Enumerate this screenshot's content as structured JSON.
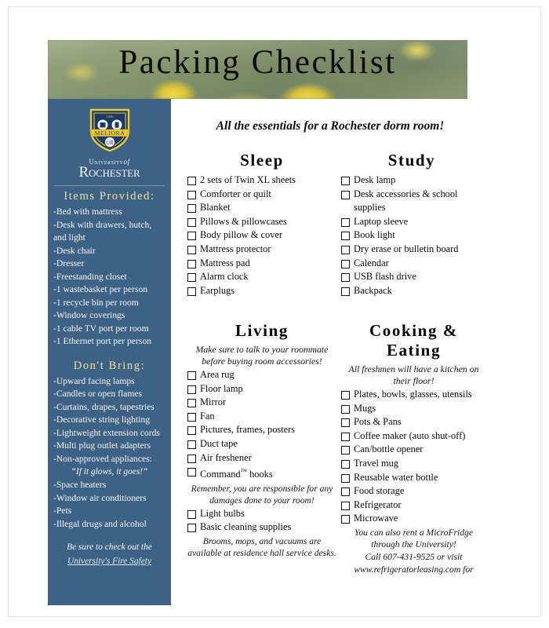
{
  "banner": {
    "title": "Packing Checklist"
  },
  "sidebar": {
    "logo": {
      "crest_motto": "MELIORA",
      "crest_year": "1850"
    },
    "wordmark": {
      "line1_pre": "University",
      "line1_italic": "of",
      "line2": "Rochester"
    },
    "provided_heading": "Items Provided:",
    "provided_items": [
      "-Bed with mattress",
      "-Desk with drawers, hutch, and light",
      "-Desk chair",
      "-Dresser",
      "-Freestanding closet",
      "-1 wastebasket per person",
      "-1 recycle bin per room",
      "-Window coverings",
      "-1 cable TV port per room",
      "-1 Ethernet port per person"
    ],
    "dont_bring_heading": "Don't Bring:",
    "dont_bring_items": [
      "-Upward facing lamps",
      "-Candles or open flames",
      "-Curtains, drapes, tapestries",
      "-Decorative string lighting",
      "-Lightweight extension cords",
      "-Multi plug outlet adapters",
      "-Non-approved appliances:"
    ],
    "appliance_quote": "“If it glows, it goes!”",
    "dont_bring_items_2": [
      "-Space heaters",
      "-Window air conditioners",
      "-Pets",
      "-Illegal drugs and alcohol"
    ],
    "footer_text": "Be sure to check out the",
    "footer_link": "University's Fire Safety"
  },
  "main": {
    "tagline": "All the essentials for a Rochester dorm room!",
    "columns": [
      {
        "title": "Sleep",
        "notes": [],
        "items": [
          "2 sets of Twin XL sheets",
          "Comforter or quilt",
          "Blanket",
          "Pillows & pillowcases",
          "Body pillow & cover",
          "Mattress protector",
          "Mattress pad",
          "Alarm clock",
          "Earplugs"
        ]
      },
      {
        "title": "Study",
        "notes": [],
        "items": [
          "Desk lamp",
          "Desk accessories & school supplies",
          "Laptop sleeve",
          "Book light",
          "Dry erase or bulletin board",
          "Calendar",
          "USB flash drive",
          "Backpack"
        ]
      },
      {
        "title": "Living",
        "subtitle": "Make sure to talk to your roommate before buying room accessories!",
        "items_a": [
          "Area rug",
          "Floor lamp",
          "Mirror",
          "Fan",
          "Pictures, frames, posters",
          "Duct tape",
          "Air freshener"
        ],
        "command_hooks": "Command",
        "command_hooks_tm": "™",
        "command_hooks_tail": " hooks",
        "mid_note": "Remember, you are responsible for any damages done to your room!",
        "items_b": [
          "Light bulbs",
          "Basic cleaning supplies"
        ],
        "end_note": "Brooms, mops, and vacuums are available at residence hall service desks."
      },
      {
        "title_line1": "Cooking &",
        "title_line2": "Eating",
        "subtitle": "All freshmen will have a kitchen on their floor!",
        "items": [
          "Plates, bowls, glasses, utensils",
          "Mugs",
          "Pots & Pans",
          "Coffee maker (auto shut-off)",
          "Can/bottle opener",
          "Travel mug",
          "Reusable water bottle",
          "Food storage",
          "Refrigerator",
          "Microwave"
        ],
        "note_1": "You can also rent a MicroFridge through the University!",
        "note_2_pre": "Call ",
        "note_2_phone": "607-431-9525",
        "note_2_post": " or visit",
        "note_3_link": "www.refrigeratorleasing.com",
        "note_3_tail": " for"
      }
    ]
  },
  "colors": {
    "sidebar_bg": "#3d6285",
    "sidebar_heading": "#e8e3a2",
    "crest_gold": "#efcb30",
    "crest_blue": "#1b3a6b",
    "text": "#0a0a0a"
  }
}
